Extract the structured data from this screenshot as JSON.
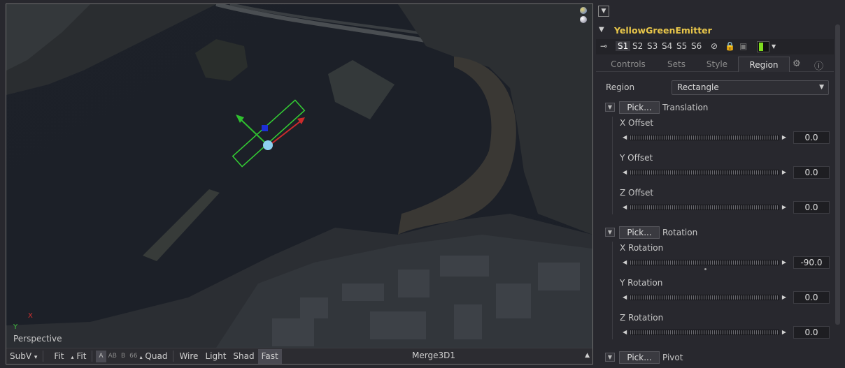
{
  "viewer": {
    "label": "Perspective",
    "axis_y": "Y",
    "axis_x": "X",
    "toolbar": {
      "subv": "SubV",
      "subv_arrow": "▾",
      "fit1": "Fit",
      "fit2": "Fit",
      "fit2_arrow": "▴",
      "btn_a": "A",
      "btn_ab": "AB",
      "btn_b": "B",
      "btn_66": "66",
      "quad_arrow": "▴",
      "quad": "Quad",
      "wire": "Wire",
      "light": "Light",
      "shad": "Shad",
      "fast": "Fast",
      "title": "Merge3D1",
      "up_arrow": "▲"
    }
  },
  "inspector": {
    "top_checkbox": "▼",
    "tool_name": "YellowGreenEmitter",
    "tool_caret": "▼",
    "pin": "⊸",
    "sets": [
      "S1",
      "S2",
      "S3",
      "S4",
      "S5",
      "S6"
    ],
    "swatch_color": "#7fdc1f",
    "tabs": [
      "Controls",
      "Sets",
      "Style",
      "Region"
    ],
    "active_tab": "Region",
    "region_label": "Region",
    "region_value": "Rectangle",
    "groups": {
      "translation": {
        "pick": "Pick...",
        "label": "Translation",
        "rows": [
          {
            "label": "X Offset",
            "value": "0.0"
          },
          {
            "label": "Y Offset",
            "value": "0.0"
          },
          {
            "label": "Z Offset",
            "value": "0.0"
          }
        ]
      },
      "rotation": {
        "pick": "Pick...",
        "label": "Rotation",
        "rows": [
          {
            "label": "X Rotation",
            "value": "-90.0"
          },
          {
            "label": "Y Rotation",
            "value": "0.0"
          },
          {
            "label": "Z Rotation",
            "value": "0.0"
          }
        ]
      },
      "pivot": {
        "pick": "Pick...",
        "label": "Pivot"
      }
    },
    "colors": {
      "tool_name": "#e8c64a",
      "panel_bg": "#28282e"
    }
  }
}
